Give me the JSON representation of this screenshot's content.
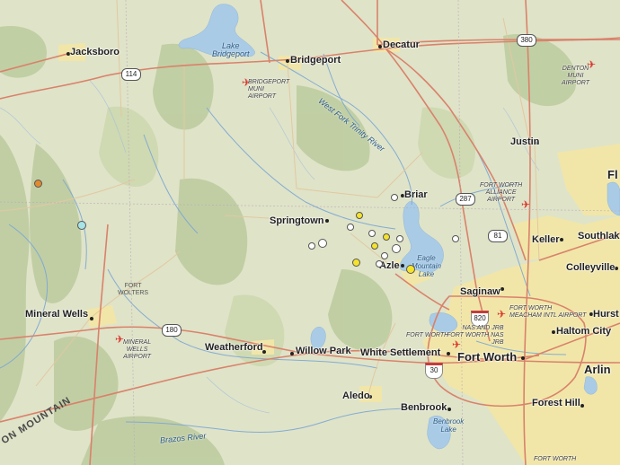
{
  "colors": {
    "land": "#dfe3c8",
    "urban": "#f3e7a6",
    "forest": "#b8c99a",
    "water": "#a9cbe6",
    "river": "#7aa7d4",
    "highway": "#d9826b",
    "road": "#e6c39a",
    "quake_yellow": "#f5e32b",
    "quake_white": "#ffffff",
    "quake_orange": "#e28a2c",
    "quake_cyan": "#a6e4e8",
    "airport": "#d9342b"
  },
  "cities": {
    "jacksboro": "Jacksboro",
    "bridgeport": "Bridgeport",
    "decatur": "Decatur",
    "justin": "Justin",
    "briar": "Briar",
    "springtown": "Springtown",
    "keller": "Keller",
    "southlake": "Southlak",
    "flower_mound": "Fl",
    "azle": "Azle",
    "colleyville": "Colleyville",
    "saginaw": "Saginaw",
    "hurst": "Hurst",
    "haltom_city": "Haltom City",
    "mineral_wells": "Mineral Wells",
    "weatherford": "Weatherford",
    "willow_park": "Willow Park",
    "white_settlement": "White Settlement",
    "fort_worth": "Fort Worth",
    "arlington": "Arlin",
    "aledo": "Aledo",
    "benbrook": "Benbrook",
    "forest_hill": "Forest Hill"
  },
  "airports": {
    "bridgeport": "BRIDGEPORT\nMUNI\nAIRPORT",
    "denton": "DENTON\nMUNI\nAIRPORT",
    "alliance": "FORT WORTH\nALLIANCE\nAIRPORT",
    "meacham": "FORT WORTH\nMEACHAM INTL AIRPORT",
    "nas": "NAS AND JRB\nFORT WORTH NAS\nJRB",
    "mineral_wells": "MINERAL\nWELLS\nAIRPORT",
    "spinks": "FORT WORTH"
  },
  "water": {
    "lake_bridgeport": "Lake\nBridgeport",
    "eagle_mountain": "Eagle\nMountain\nLake",
    "benbrook": "Benbrook\nLake",
    "west_fork": "West Fork Trinity River",
    "brazos": "Brazos River"
  },
  "features": {
    "fort_wolters": "FORT\nWOLTERS",
    "mountain": "ON MOUNTAIN",
    "fort_worth_nas_label": "FORT WORTH"
  },
  "shields": {
    "us380": "380",
    "us114": "114",
    "us287": "287",
    "us81": "81",
    "i820": "820",
    "tx180": "180",
    "i30": "30"
  },
  "earthquakes": [
    {
      "color": "orange",
      "size": 9
    },
    {
      "color": "cyan",
      "size": 10
    },
    {
      "color": "white",
      "size": 8
    },
    {
      "color": "yellow",
      "size": 8
    },
    {
      "color": "white",
      "size": 8
    },
    {
      "color": "white",
      "size": 10
    },
    {
      "color": "white",
      "size": 8
    },
    {
      "color": "white",
      "size": 8
    },
    {
      "color": "yellow",
      "size": 8
    },
    {
      "color": "white",
      "size": 8
    },
    {
      "color": "yellow",
      "size": 8
    },
    {
      "color": "white",
      "size": 10
    },
    {
      "color": "white",
      "size": 8
    },
    {
      "color": "yellow",
      "size": 9
    },
    {
      "color": "yellow",
      "size": 10
    },
    {
      "color": "white",
      "size": 8
    },
    {
      "color": "white",
      "size": 8
    }
  ]
}
